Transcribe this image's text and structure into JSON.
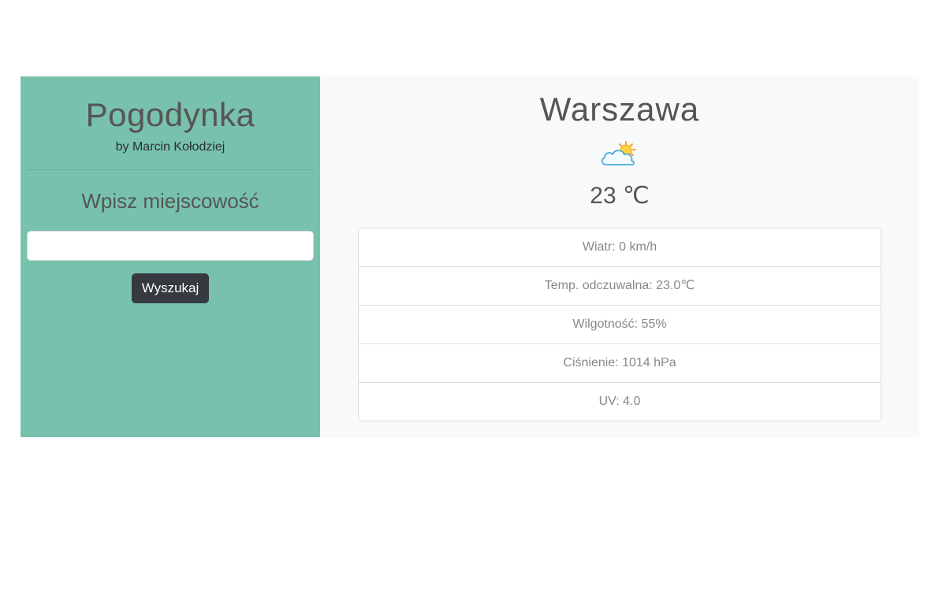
{
  "sidebar": {
    "title": "Pogodynka",
    "author": "by Marcin Kołodziej",
    "search_heading": "Wpisz miejscowość",
    "search_input_value": "",
    "search_button_label": "Wyszukaj"
  },
  "main": {
    "city": "Warszawa",
    "weather_icon": "partly-cloudy-icon",
    "temperature": "23 ℃",
    "details": [
      "Wiatr: 0 km/h",
      "Temp. odczuwalna: 23.0℃",
      "Wilgotność: 55%",
      "Ciśnienie: 1014 hPa",
      "UV: 4.0"
    ]
  },
  "colors": {
    "sidebar_bg": "#78c2ad",
    "main_bg": "#f8f9fa",
    "button_bg": "#343a40"
  }
}
